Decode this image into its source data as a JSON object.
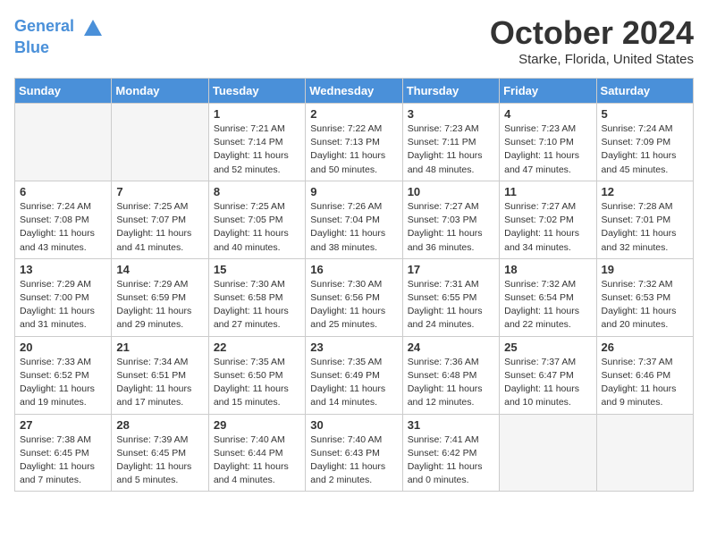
{
  "logo": {
    "line1": "General",
    "line2": "Blue"
  },
  "title": "October 2024",
  "location": "Starke, Florida, United States",
  "days_of_week": [
    "Sunday",
    "Monday",
    "Tuesday",
    "Wednesday",
    "Thursday",
    "Friday",
    "Saturday"
  ],
  "weeks": [
    [
      {
        "day": "",
        "empty": true
      },
      {
        "day": "",
        "empty": true
      },
      {
        "day": "1",
        "sunrise": "Sunrise: 7:21 AM",
        "sunset": "Sunset: 7:14 PM",
        "daylight": "Daylight: 11 hours and 52 minutes."
      },
      {
        "day": "2",
        "sunrise": "Sunrise: 7:22 AM",
        "sunset": "Sunset: 7:13 PM",
        "daylight": "Daylight: 11 hours and 50 minutes."
      },
      {
        "day": "3",
        "sunrise": "Sunrise: 7:23 AM",
        "sunset": "Sunset: 7:11 PM",
        "daylight": "Daylight: 11 hours and 48 minutes."
      },
      {
        "day": "4",
        "sunrise": "Sunrise: 7:23 AM",
        "sunset": "Sunset: 7:10 PM",
        "daylight": "Daylight: 11 hours and 47 minutes."
      },
      {
        "day": "5",
        "sunrise": "Sunrise: 7:24 AM",
        "sunset": "Sunset: 7:09 PM",
        "daylight": "Daylight: 11 hours and 45 minutes."
      }
    ],
    [
      {
        "day": "6",
        "sunrise": "Sunrise: 7:24 AM",
        "sunset": "Sunset: 7:08 PM",
        "daylight": "Daylight: 11 hours and 43 minutes."
      },
      {
        "day": "7",
        "sunrise": "Sunrise: 7:25 AM",
        "sunset": "Sunset: 7:07 PM",
        "daylight": "Daylight: 11 hours and 41 minutes."
      },
      {
        "day": "8",
        "sunrise": "Sunrise: 7:25 AM",
        "sunset": "Sunset: 7:05 PM",
        "daylight": "Daylight: 11 hours and 40 minutes."
      },
      {
        "day": "9",
        "sunrise": "Sunrise: 7:26 AM",
        "sunset": "Sunset: 7:04 PM",
        "daylight": "Daylight: 11 hours and 38 minutes."
      },
      {
        "day": "10",
        "sunrise": "Sunrise: 7:27 AM",
        "sunset": "Sunset: 7:03 PM",
        "daylight": "Daylight: 11 hours and 36 minutes."
      },
      {
        "day": "11",
        "sunrise": "Sunrise: 7:27 AM",
        "sunset": "Sunset: 7:02 PM",
        "daylight": "Daylight: 11 hours and 34 minutes."
      },
      {
        "day": "12",
        "sunrise": "Sunrise: 7:28 AM",
        "sunset": "Sunset: 7:01 PM",
        "daylight": "Daylight: 11 hours and 32 minutes."
      }
    ],
    [
      {
        "day": "13",
        "sunrise": "Sunrise: 7:29 AM",
        "sunset": "Sunset: 7:00 PM",
        "daylight": "Daylight: 11 hours and 31 minutes."
      },
      {
        "day": "14",
        "sunrise": "Sunrise: 7:29 AM",
        "sunset": "Sunset: 6:59 PM",
        "daylight": "Daylight: 11 hours and 29 minutes."
      },
      {
        "day": "15",
        "sunrise": "Sunrise: 7:30 AM",
        "sunset": "Sunset: 6:58 PM",
        "daylight": "Daylight: 11 hours and 27 minutes."
      },
      {
        "day": "16",
        "sunrise": "Sunrise: 7:30 AM",
        "sunset": "Sunset: 6:56 PM",
        "daylight": "Daylight: 11 hours and 25 minutes."
      },
      {
        "day": "17",
        "sunrise": "Sunrise: 7:31 AM",
        "sunset": "Sunset: 6:55 PM",
        "daylight": "Daylight: 11 hours and 24 minutes."
      },
      {
        "day": "18",
        "sunrise": "Sunrise: 7:32 AM",
        "sunset": "Sunset: 6:54 PM",
        "daylight": "Daylight: 11 hours and 22 minutes."
      },
      {
        "day": "19",
        "sunrise": "Sunrise: 7:32 AM",
        "sunset": "Sunset: 6:53 PM",
        "daylight": "Daylight: 11 hours and 20 minutes."
      }
    ],
    [
      {
        "day": "20",
        "sunrise": "Sunrise: 7:33 AM",
        "sunset": "Sunset: 6:52 PM",
        "daylight": "Daylight: 11 hours and 19 minutes."
      },
      {
        "day": "21",
        "sunrise": "Sunrise: 7:34 AM",
        "sunset": "Sunset: 6:51 PM",
        "daylight": "Daylight: 11 hours and 17 minutes."
      },
      {
        "day": "22",
        "sunrise": "Sunrise: 7:35 AM",
        "sunset": "Sunset: 6:50 PM",
        "daylight": "Daylight: 11 hours and 15 minutes."
      },
      {
        "day": "23",
        "sunrise": "Sunrise: 7:35 AM",
        "sunset": "Sunset: 6:49 PM",
        "daylight": "Daylight: 11 hours and 14 minutes."
      },
      {
        "day": "24",
        "sunrise": "Sunrise: 7:36 AM",
        "sunset": "Sunset: 6:48 PM",
        "daylight": "Daylight: 11 hours and 12 minutes."
      },
      {
        "day": "25",
        "sunrise": "Sunrise: 7:37 AM",
        "sunset": "Sunset: 6:47 PM",
        "daylight": "Daylight: 11 hours and 10 minutes."
      },
      {
        "day": "26",
        "sunrise": "Sunrise: 7:37 AM",
        "sunset": "Sunset: 6:46 PM",
        "daylight": "Daylight: 11 hours and 9 minutes."
      }
    ],
    [
      {
        "day": "27",
        "sunrise": "Sunrise: 7:38 AM",
        "sunset": "Sunset: 6:45 PM",
        "daylight": "Daylight: 11 hours and 7 minutes."
      },
      {
        "day": "28",
        "sunrise": "Sunrise: 7:39 AM",
        "sunset": "Sunset: 6:45 PM",
        "daylight": "Daylight: 11 hours and 5 minutes."
      },
      {
        "day": "29",
        "sunrise": "Sunrise: 7:40 AM",
        "sunset": "Sunset: 6:44 PM",
        "daylight": "Daylight: 11 hours and 4 minutes."
      },
      {
        "day": "30",
        "sunrise": "Sunrise: 7:40 AM",
        "sunset": "Sunset: 6:43 PM",
        "daylight": "Daylight: 11 hours and 2 minutes."
      },
      {
        "day": "31",
        "sunrise": "Sunrise: 7:41 AM",
        "sunset": "Sunset: 6:42 PM",
        "daylight": "Daylight: 11 hours and 0 minutes."
      },
      {
        "day": "",
        "empty": true
      },
      {
        "day": "",
        "empty": true
      }
    ]
  ]
}
